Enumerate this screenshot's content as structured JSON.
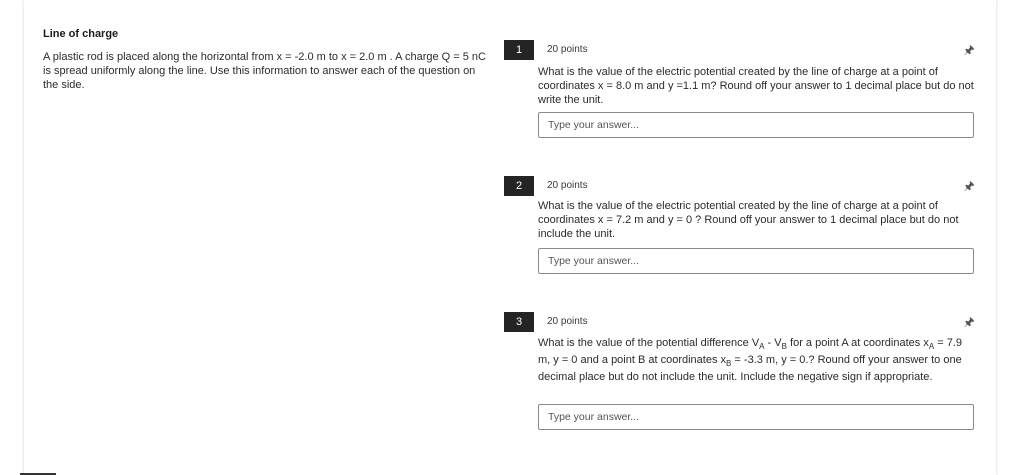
{
  "section": {
    "title": "Line of charge",
    "body": "A plastic rod is placed along the horizontal from x = -2.0 m to x = 2.0 m . A charge Q = 5 nC is spread uniformly along the line. Use this information to answer each of the question on the side."
  },
  "pin_icon": "pin-icon",
  "questions": [
    {
      "number": "1",
      "points": "20 points",
      "text": "What is the value of the electric potential created by the line of charge at a point of coordinates x = 8.0 m and y =1.1 m? Round off your answer to 1 decimal place but do not write the unit.",
      "placeholder": "Type your answer..."
    },
    {
      "number": "2",
      "points": "20 points",
      "text": "What is the value of the electric potential created by the line of charge at a point of coordinates x = 7.2 m and y = 0 ? Round off your answer to 1 decimal place but do not include the unit.",
      "placeholder": "Type your answer..."
    },
    {
      "number": "3",
      "points": "20 points",
      "text_a": "What is the value of the potential difference V",
      "sub_a": "A",
      "text_b": " - V",
      "sub_b": "B",
      "text_c": " for a point A at coordinates x",
      "sub_c": "A",
      "text_d": " = 7.9 m, y = 0 and a point B at  coordinates x",
      "sub_d": "B",
      "text_e": " = -3.3 m, y = 0.? Round off your answer to one decimal place but do not include the unit. Include the negative sign if appropriate.",
      "placeholder": "Type your answer..."
    }
  ]
}
